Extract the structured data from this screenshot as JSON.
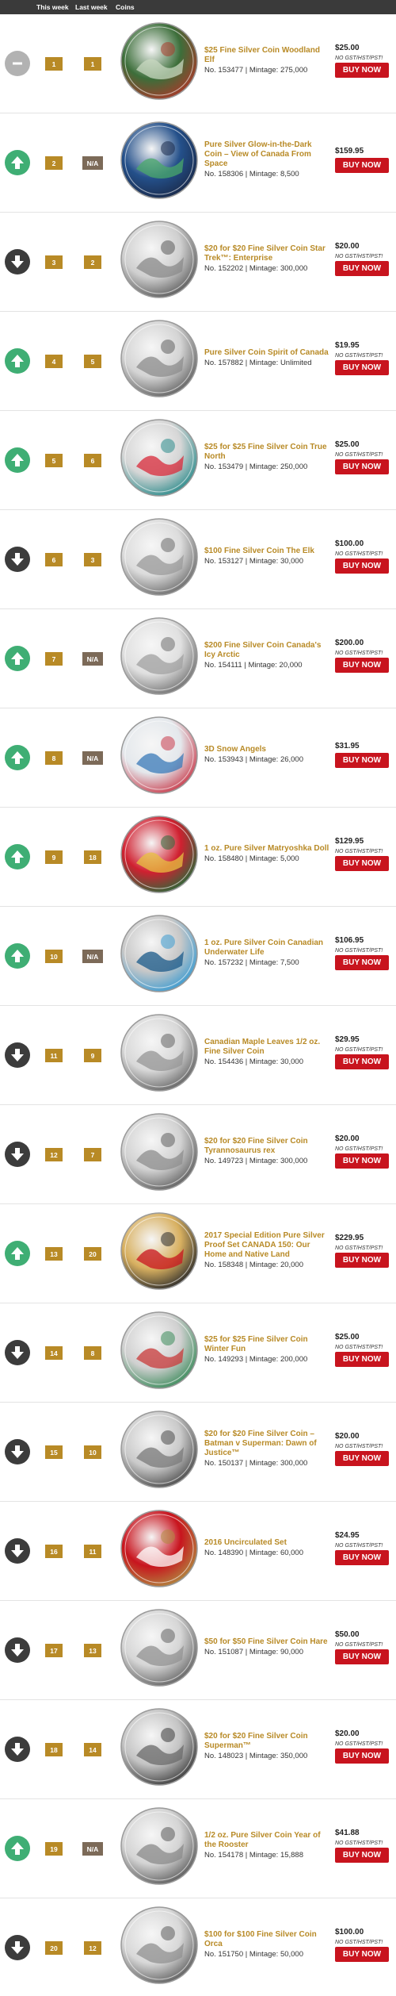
{
  "header": {
    "col_this_week": "This week",
    "col_last_week": "Last week",
    "col_coins": "Coins"
  },
  "colors": {
    "header_bg": "#3a3a3a",
    "rank_gold": "#b88a26",
    "na_brown": "#7c6a58",
    "trend_up": "#3fae74",
    "trend_down": "#3c3c3c",
    "trend_same": "#b2b2b2",
    "buy_red": "#c8141e"
  },
  "rows": [
    {
      "trend": "same",
      "trend_icon": "no-change-icon",
      "rank": "1",
      "last": "1",
      "title": "$25 Fine Silver Coin Woodland Elf",
      "meta": "No. 153477 | Mintage: 275,000",
      "price": "$25.00",
      "tax": "NO GST/HST/PST!",
      "buy": "BUY NOW",
      "coin_icon": "woodland-elf-coin",
      "coin_colors": [
        "#3c6e3a",
        "#c8d8c0",
        "#a83a2a"
      ]
    },
    {
      "trend": "up",
      "trend_icon": "arrow-up-icon",
      "rank": "2",
      "last": "N/A",
      "title": "Pure Silver Glow-in-the-Dark Coin – View of Canada From Space",
      "meta": "No. 158306 | Mintage: 8,500",
      "price": "$159.95",
      "tax": "",
      "buy": "BUY NOW",
      "coin_icon": "canada-from-space-coin",
      "coin_colors": [
        "#24508a",
        "#4aa86a",
        "#1a2a4a"
      ]
    },
    {
      "trend": "down",
      "trend_icon": "arrow-down-icon",
      "rank": "3",
      "last": "2",
      "title": "$20 for $20 Fine Silver Coin Star Trek™: Enterprise",
      "meta": "No. 152202 | Mintage: 300,000",
      "price": "$20.00",
      "tax": "NO GST/HST/PST!",
      "buy": "BUY NOW",
      "coin_icon": "star-trek-enterprise-coin",
      "coin_colors": [
        "#cfcfcf",
        "#8a8a8a",
        "#5a5a5a"
      ]
    },
    {
      "trend": "up",
      "trend_icon": "arrow-up-icon",
      "rank": "4",
      "last": "5",
      "title": "Pure Silver Coin Spirit of Canada",
      "meta": "No. 157882 | Mintage: Unlimited",
      "price": "$19.95",
      "tax": "NO GST/HST/PST!",
      "buy": "BUY NOW",
      "coin_icon": "spirit-of-canada-coin",
      "coin_colors": [
        "#d4d4d4",
        "#8c8c8c",
        "#606060"
      ]
    },
    {
      "trend": "up",
      "trend_icon": "arrow-up-icon",
      "rank": "5",
      "last": "6",
      "title": "$25 for $25 Fine Silver Coin True North",
      "meta": "No. 153479 | Mintage: 250,000",
      "price": "$25.00",
      "tax": "NO GST/HST/PST!",
      "buy": "BUY NOW",
      "coin_icon": "true-north-coin",
      "coin_colors": [
        "#d6d6d6",
        "#d82a3a",
        "#2a8a8a"
      ]
    },
    {
      "trend": "down",
      "trend_icon": "arrow-down-icon",
      "rank": "6",
      "last": "3",
      "title": "$100 Fine Silver Coin The Elk",
      "meta": "No. 153127 | Mintage: 30,000",
      "price": "$100.00",
      "tax": "NO GST/HST/PST!",
      "buy": "BUY NOW",
      "coin_icon": "elk-coin",
      "coin_colors": [
        "#dcdcdc",
        "#9a9a9a",
        "#6a6a6a"
      ]
    },
    {
      "trend": "up",
      "trend_icon": "arrow-up-icon",
      "rank": "7",
      "last": "N/A",
      "title": "$200 Fine Silver Coin Canada's Icy Arctic",
      "meta": "No. 154111 | Mintage: 20,000",
      "price": "$200.00",
      "tax": "NO GST/HST/PST!",
      "buy": "BUY NOW",
      "coin_icon": "icy-arctic-coin",
      "coin_colors": [
        "#e0e0e0",
        "#a0a0a0",
        "#707070"
      ]
    },
    {
      "trend": "up",
      "trend_icon": "arrow-up-icon",
      "rank": "8",
      "last": "N/A",
      "title": "3D Snow Angels",
      "meta": "No. 153943 | Mintage: 26,000",
      "price": "$31.95",
      "tax": "",
      "buy": "BUY NOW",
      "coin_icon": "snow-angels-coin",
      "coin_colors": [
        "#e4e8ec",
        "#3a7ab8",
        "#c83a4a"
      ]
    },
    {
      "trend": "up",
      "trend_icon": "arrow-up-icon",
      "rank": "9",
      "last": "18",
      "title": "1 oz. Pure Silver Matryoshka Doll",
      "meta": "No. 158480 | Mintage: 5,000",
      "price": "$129.95",
      "tax": "NO GST/HST/PST!",
      "buy": "BUY NOW",
      "coin_icon": "matryoshka-doll-coin",
      "coin_colors": [
        "#d02030",
        "#e8c040",
        "#2a6a3a"
      ]
    },
    {
      "trend": "up",
      "trend_icon": "arrow-up-icon",
      "rank": "10",
      "last": "N/A",
      "title": "1 oz. Pure Silver Coin Canadian Underwater Life",
      "meta": "No. 157232 | Mintage: 7,500",
      "price": "$106.95",
      "tax": "NO GST/HST/PST!",
      "buy": "BUY NOW",
      "coin_icon": "underwater-life-coin",
      "coin_colors": [
        "#c8c8c8",
        "#1a5a8a",
        "#3a9ad0"
      ]
    },
    {
      "trend": "down",
      "trend_icon": "arrow-down-icon",
      "rank": "11",
      "last": "9",
      "title": "Canadian Maple Leaves 1/2 oz. Fine Silver Coin",
      "meta": "No. 154436 | Mintage: 30,000",
      "price": "$29.95",
      "tax": "NO GST/HST/PST!",
      "buy": "BUY NOW",
      "coin_icon": "maple-leaves-coin",
      "coin_colors": [
        "#d8d8d8",
        "#969696",
        "#626262"
      ]
    },
    {
      "trend": "down",
      "trend_icon": "arrow-down-icon",
      "rank": "12",
      "last": "7",
      "title": "$20 for $20 Fine Silver Coin Tyrannosaurus rex",
      "meta": "No. 149723 | Mintage: 300,000",
      "price": "$20.00",
      "tax": "NO GST/HST/PST!",
      "buy": "BUY NOW",
      "coin_icon": "tyrannosaurus-rex-coin",
      "coin_colors": [
        "#d2d2d2",
        "#8e8e8e",
        "#5e5e5e"
      ]
    },
    {
      "trend": "up",
      "trend_icon": "arrow-up-icon",
      "rank": "13",
      "last": "20",
      "title": "2017 Special Edition Pure Silver Proof Set CANADA 150: Our Home and Native Land",
      "meta": "No. 158348 | Mintage: 20,000",
      "price": "$229.95",
      "tax": "NO GST/HST/PST!",
      "buy": "BUY NOW",
      "coin_icon": "canada-150-proof-set",
      "coin_colors": [
        "#d8b060",
        "#c8141e",
        "#2a2a2a"
      ]
    },
    {
      "trend": "down",
      "trend_icon": "arrow-down-icon",
      "rank": "14",
      "last": "8",
      "title": "$25 for $25 Fine Silver Coin Winter Fun",
      "meta": "No. 149293 | Mintage: 200,000",
      "price": "$25.00",
      "tax": "NO GST/HST/PST!",
      "buy": "BUY NOW",
      "coin_icon": "winter-fun-coin",
      "coin_colors": [
        "#d0d0d0",
        "#c83a3a",
        "#3a8a5a"
      ]
    },
    {
      "trend": "down",
      "trend_icon": "arrow-down-icon",
      "rank": "15",
      "last": "10",
      "title": "$20 for $20 Fine Silver Coin – Batman v Superman: Dawn of Justice™",
      "meta": "No. 150137 | Mintage: 300,000",
      "price": "$20.00",
      "tax": "NO GST/HST/PST!",
      "buy": "BUY NOW",
      "coin_icon": "batman-v-superman-coin",
      "coin_colors": [
        "#cacaca",
        "#7a7a7a",
        "#4a4a4a"
      ]
    },
    {
      "trend": "down",
      "trend_icon": "arrow-down-icon",
      "rank": "16",
      "last": "11",
      "title": "2016 Uncirculated Set",
      "meta": "No. 148390 | Mintage: 60,000",
      "price": "$24.95",
      "tax": "NO GST/HST/PST!",
      "buy": "BUY NOW",
      "coin_icon": "uncirculated-set",
      "coin_colors": [
        "#c8141e",
        "#ffffff",
        "#b08a40"
      ]
    },
    {
      "trend": "down",
      "trend_icon": "arrow-down-icon",
      "rank": "17",
      "last": "13",
      "title": "$50 for $50 Fine Silver Coin Hare",
      "meta": "No. 151087 | Mintage: 90,000",
      "price": "$50.00",
      "tax": "NO GST/HST/PST!",
      "buy": "BUY NOW",
      "coin_icon": "hare-coin",
      "coin_colors": [
        "#d6d6d6",
        "#929292",
        "#626262"
      ]
    },
    {
      "trend": "down",
      "trend_icon": "arrow-down-icon",
      "rank": "18",
      "last": "14",
      "title": "$20 for $20 Fine Silver Coin Superman™",
      "meta": "No. 148023 | Mintage: 350,000",
      "price": "$20.00",
      "tax": "NO GST/HST/PST!",
      "buy": "BUY NOW",
      "coin_icon": "superman-coin",
      "coin_colors": [
        "#c4c4c4",
        "#6a6a6a",
        "#3a3a3a"
      ]
    },
    {
      "trend": "up",
      "trend_icon": "arrow-up-icon",
      "rank": "19",
      "last": "N/A",
      "title": "1/2 oz. Pure Silver Coin Year of the Rooster",
      "meta": "No. 154178 | Mintage: 15,888",
      "price": "$41.88",
      "tax": "NO GST/HST/PST!",
      "buy": "BUY NOW",
      "coin_icon": "year-of-rooster-coin",
      "coin_colors": [
        "#d4d4d4",
        "#8a8a8a",
        "#5a5a5a"
      ]
    },
    {
      "trend": "down",
      "trend_icon": "arrow-down-icon",
      "rank": "20",
      "last": "12",
      "title": "$100 for $100 Fine Silver Coin Orca",
      "meta": "No. 151750 | Mintage: 50,000",
      "price": "$100.00",
      "tax": "NO GST/HST/PST!",
      "buy": "BUY NOW",
      "coin_icon": "orca-coin",
      "coin_colors": [
        "#d8d8d8",
        "#909090",
        "#5c5c5c"
      ]
    }
  ]
}
